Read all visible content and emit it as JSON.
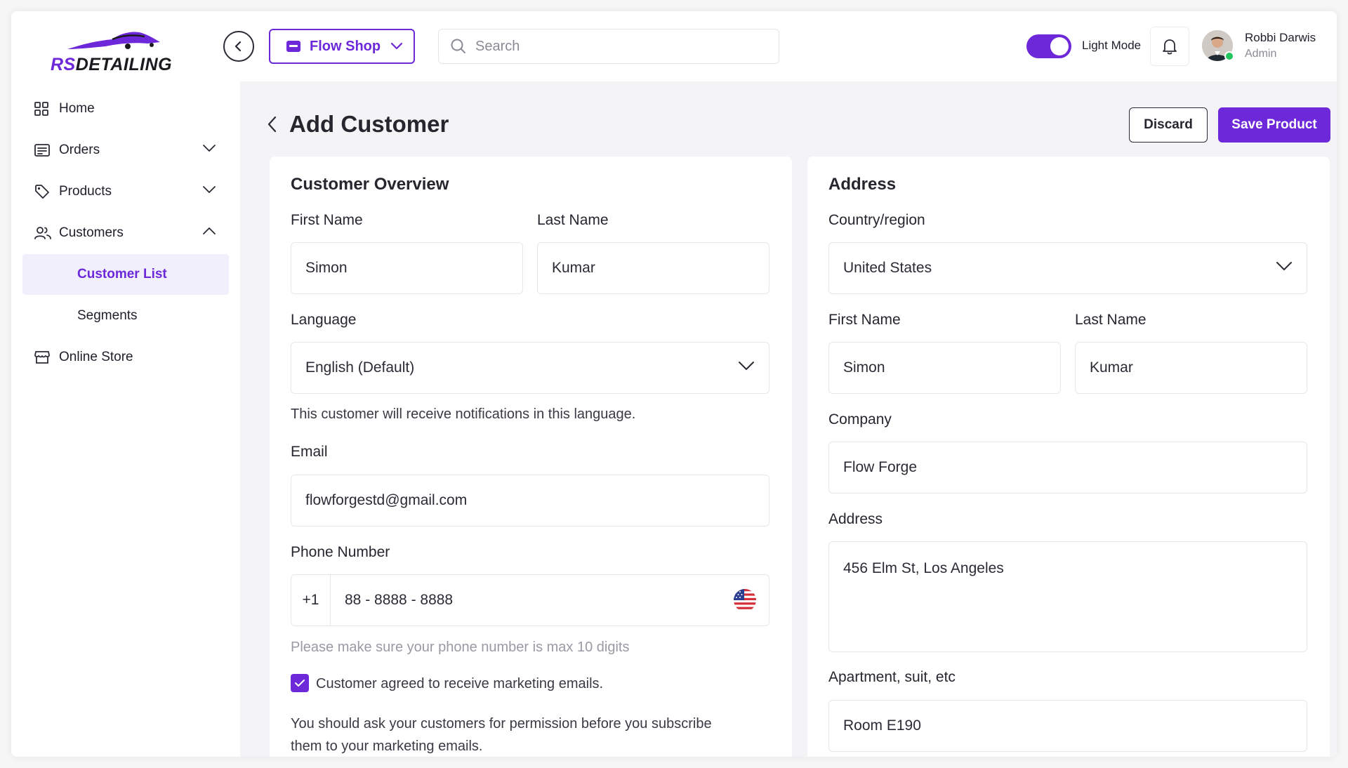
{
  "brand": {
    "logo_prefix": "RS",
    "logo_suffix": "DETAILING",
    "accent": "#6d28d9"
  },
  "topbar": {
    "shop_label": "Flow Shop",
    "search_placeholder": "Search",
    "mode_label": "Light Mode",
    "mode_on": true,
    "user_name": "Robbi Darwis",
    "user_role": "Admin"
  },
  "sidebar": {
    "items": [
      {
        "label": "Home",
        "icon": "grid-icon"
      },
      {
        "label": "Orders",
        "icon": "receipt-icon",
        "expandable": true
      },
      {
        "label": "Products",
        "icon": "tag-icon",
        "expandable": true
      },
      {
        "label": "Customers",
        "icon": "users-icon",
        "expandable": true,
        "expanded": true
      },
      {
        "label": "Customer List",
        "sub": true,
        "active": true
      },
      {
        "label": "Segments",
        "sub": true
      },
      {
        "label": "Online Store",
        "icon": "store-icon"
      }
    ]
  },
  "page": {
    "title": "Add Customer",
    "discard_label": "Discard",
    "save_label": "Save Product"
  },
  "overview": {
    "title": "Customer Overview",
    "first_name_label": "First Name",
    "first_name": "Simon",
    "last_name_label": "Last Name",
    "last_name": "Kumar",
    "language_label": "Language",
    "language": "English (Default)",
    "language_help": "This customer will receive notifications in this language.",
    "email_label": "Email",
    "email": "flowforgestd@gmail.com",
    "phone_label": "Phone Number",
    "phone_code": "+1",
    "phone": "88 - 8888 - 8888",
    "phone_help": "Please make sure your phone number is max 10 digits",
    "marketing_label": "Customer agreed to receive marketing emails.",
    "marketing_checked": true,
    "marketing_help_1": "You should ask your customers for permission before you subscribe",
    "marketing_help_2": "them to your marketing emails."
  },
  "address": {
    "title": "Address",
    "country_label": "Country/region",
    "country": "United States",
    "first_name_label": "First Name",
    "first_name": "Simon",
    "last_name_label": "Last Name",
    "last_name": "Kumar",
    "company_label": "Company",
    "company": "Flow Forge",
    "address_label": "Address",
    "address": "456 Elm St, Los Angeles",
    "apartment_label": "Apartment, suit, etc",
    "apartment": "Room E190"
  }
}
